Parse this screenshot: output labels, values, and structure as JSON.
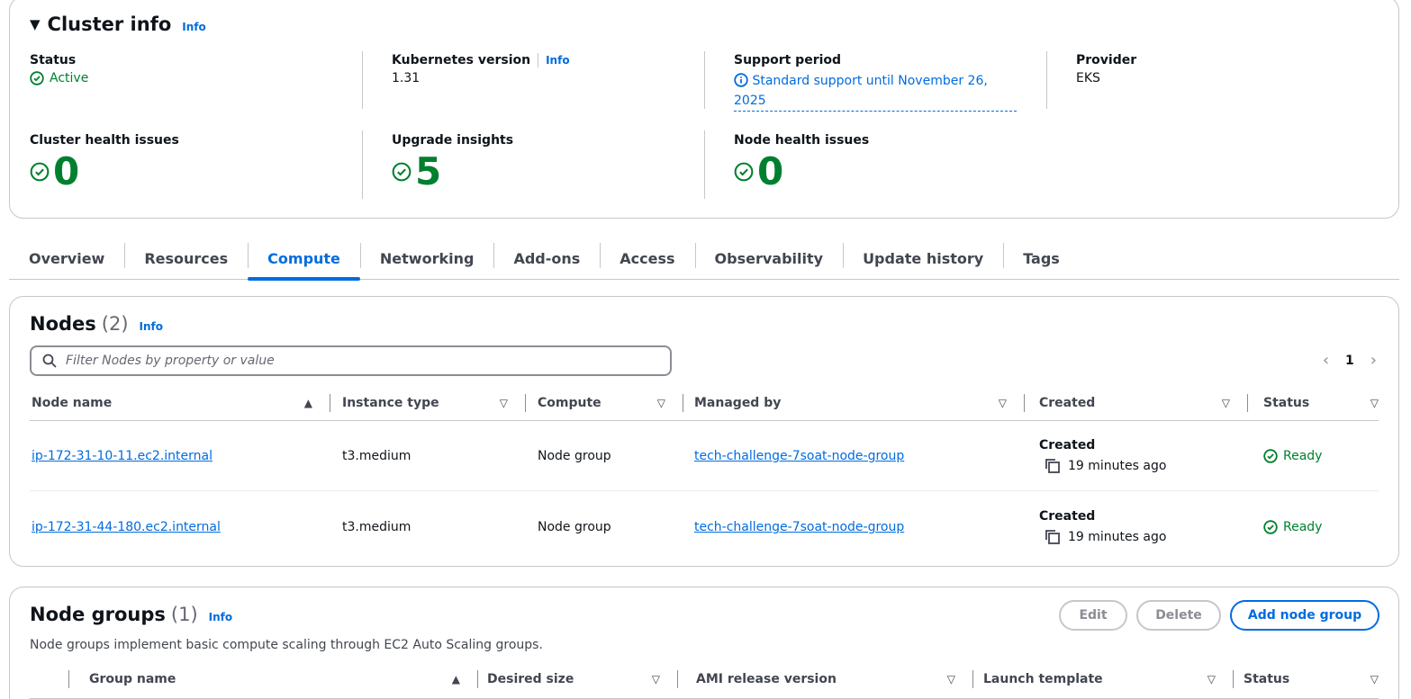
{
  "cluster_info": {
    "title": "Cluster info",
    "info": "Info",
    "status_label": "Status",
    "status_value": "Active",
    "k8s_label": "Kubernetes version",
    "k8s_info": "Info",
    "k8s_value": "1.31",
    "support_label": "Support period",
    "support_line1": "Standard support until November 26,",
    "support_line2": "2025",
    "provider_label": "Provider",
    "provider_value": "EKS",
    "cluster_health_label": "Cluster health issues",
    "cluster_health_value": "0",
    "upgrade_label": "Upgrade insights",
    "upgrade_value": "5",
    "node_health_label": "Node health issues",
    "node_health_value": "0"
  },
  "tabs": [
    "Overview",
    "Resources",
    "Compute",
    "Networking",
    "Add-ons",
    "Access",
    "Observability",
    "Update history",
    "Tags"
  ],
  "active_tab": "Compute",
  "nodes": {
    "title": "Nodes",
    "count": "(2)",
    "info": "Info",
    "filter_placeholder": "Filter Nodes by property or value",
    "page": "1",
    "columns": [
      "Node name",
      "Instance type",
      "Compute",
      "Managed by",
      "Created",
      "Status"
    ],
    "rows": [
      {
        "name": "ip-172-31-10-11.ec2.internal",
        "instance_type": "t3.medium",
        "compute": "Node group",
        "managed_by": "tech-challenge-7soat-node-group",
        "created_label": "Created",
        "created": "19 minutes ago",
        "status": "Ready"
      },
      {
        "name": "ip-172-31-44-180.ec2.internal",
        "instance_type": "t3.medium",
        "compute": "Node group",
        "managed_by": "tech-challenge-7soat-node-group",
        "created_label": "Created",
        "created": "19 minutes ago",
        "status": "Ready"
      }
    ]
  },
  "node_groups": {
    "title": "Node groups",
    "count": "(1)",
    "info": "Info",
    "description": "Node groups implement basic compute scaling through EC2 Auto Scaling groups.",
    "edit_label": "Edit",
    "delete_label": "Delete",
    "add_label": "Add node group",
    "columns": [
      "Group name",
      "Desired size",
      "AMI release version",
      "Launch template",
      "Status"
    ]
  },
  "colors": {
    "accent": "#006ce0",
    "success": "#00802f",
    "border": "#c6c6cd"
  }
}
